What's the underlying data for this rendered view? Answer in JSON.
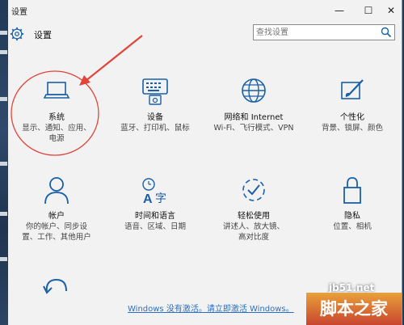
{
  "window": {
    "title": "设置"
  },
  "header": {
    "title": "设置",
    "search_placeholder": "查找设置"
  },
  "tiles": [
    {
      "name": "系统",
      "desc": "显示、通知、应用、电源"
    },
    {
      "name": "设备",
      "desc": "蓝牙、打印机、鼠标"
    },
    {
      "name": "网络和 Internet",
      "desc": "Wi-Fi、飞行模式、VPN"
    },
    {
      "name": "个性化",
      "desc": "背景、锁屏、颜色"
    },
    {
      "name": "帐户",
      "desc": "你的帐户、同步设置、工作、其他用户"
    },
    {
      "name": "时间和语言",
      "desc": "语音、区域、日期"
    },
    {
      "name": "轻松使用",
      "desc": "讲述人、放大镜、高对比度"
    },
    {
      "name": "隐私",
      "desc": "位置、相机"
    }
  ],
  "activation_link": "Windows 没有激活。请立即激活 Windows。",
  "watermark": {
    "site": "jb51.net",
    "name": "脚本之家"
  },
  "colors": {
    "accent": "#1a5fa8",
    "annotation": "#e0443a",
    "link": "#2c6fbf"
  }
}
